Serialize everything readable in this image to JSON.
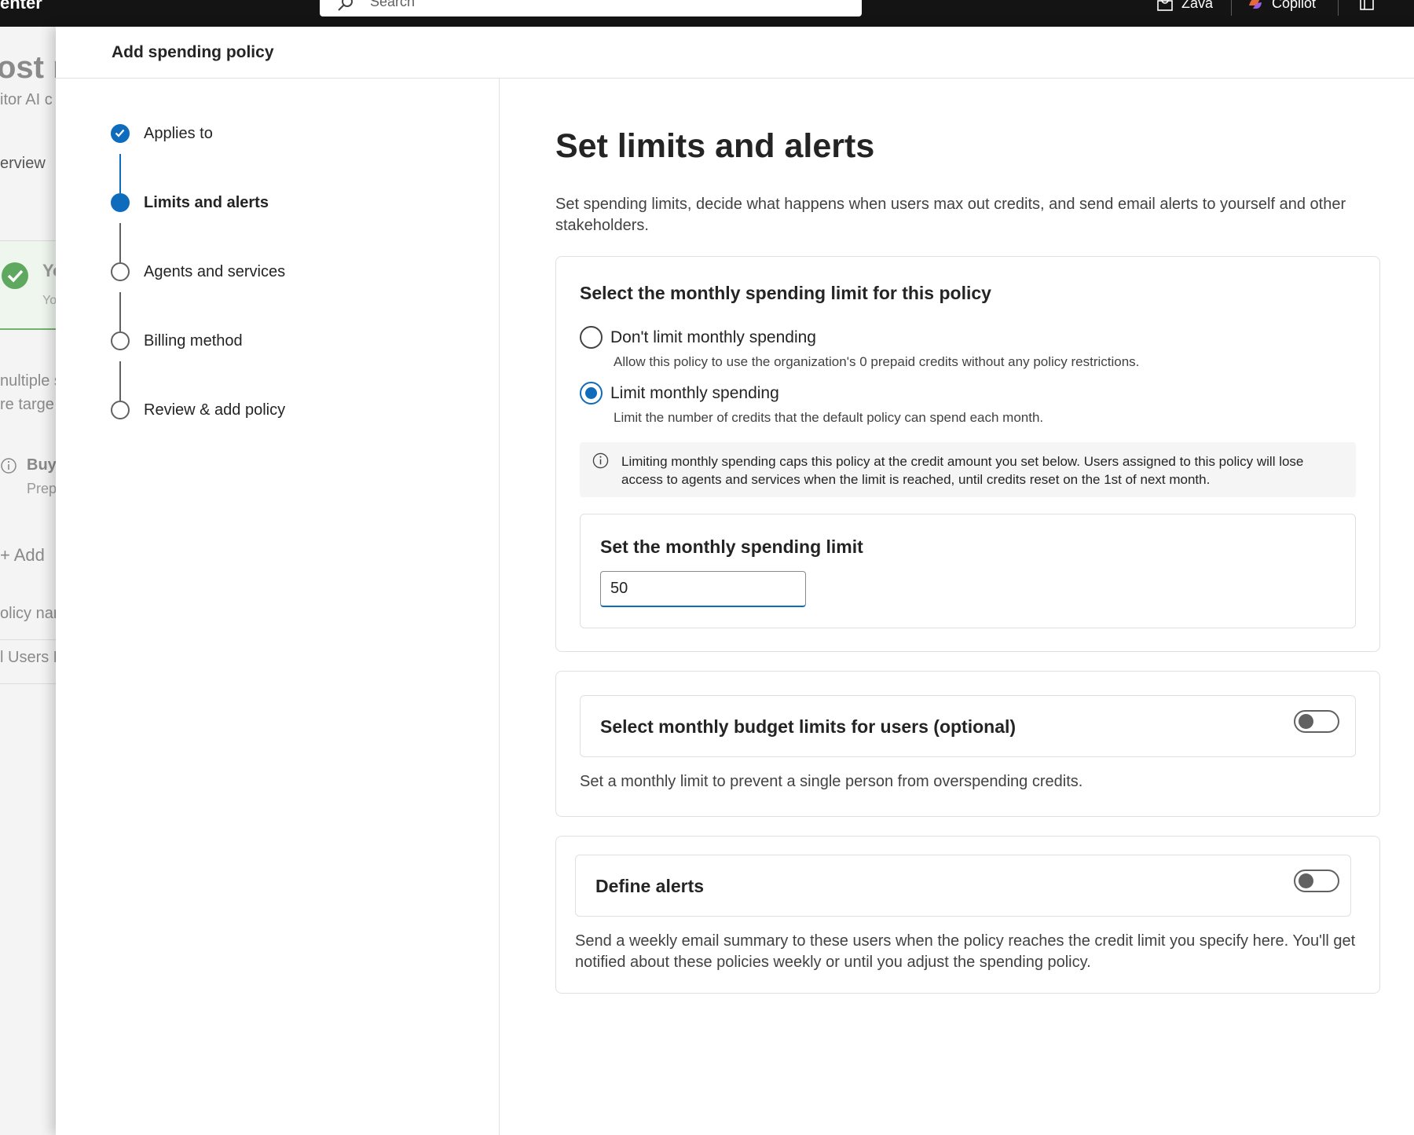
{
  "topbar": {
    "app_title_fragment": "enter",
    "search_placeholder": "Search",
    "org_name": "Zava",
    "copilot_label": "Copilot"
  },
  "background_page": {
    "title_fragment": "ost m",
    "subtitle_fragment": "itor AI c",
    "nav_overview": "erview",
    "status_title": "Yo",
    "status_sub": "Yo",
    "text_multiple": "nultiple s",
    "text_target": "re targe",
    "buy_title": "Buy",
    "buy_sub": "Prep",
    "add_button": "Add",
    "col_policy_name": "olicy nar",
    "row_users": "l Users F"
  },
  "panel": {
    "title": "Add spending policy",
    "steps": [
      {
        "label": "Applies to",
        "state": "done"
      },
      {
        "label": "Limits and alerts",
        "state": "current"
      },
      {
        "label": "Agents and services",
        "state": "pending"
      },
      {
        "label": "Billing method",
        "state": "pending"
      },
      {
        "label": "Review & add policy",
        "state": "pending"
      }
    ]
  },
  "main": {
    "heading": "Set limits and alerts",
    "intro": "Set spending limits, decide what happens when users max out credits, and send email alerts to yourself and other stakeholders.",
    "monthly_limit": {
      "title": "Select the monthly spending limit for this policy",
      "options": [
        {
          "label": "Don't limit monthly spending",
          "description": "Allow this policy to use the organization's 0 prepaid credits without any policy restrictions.",
          "selected": false
        },
        {
          "label": "Limit monthly spending",
          "description": "Limit the number of credits that the default policy can spend each month.",
          "selected": true
        }
      ],
      "info_text": "Limiting monthly spending caps this policy at the credit amount you set below. Users assigned to this policy will lose access to agents and services when the limit is reached, until credits reset on the 1st of next month.",
      "limit_title": "Set the monthly spending limit",
      "limit_value": "50"
    },
    "user_budget": {
      "title": "Select monthly budget limits for users (optional)",
      "description": "Set a monthly limit to prevent a single person from overspending credits.",
      "enabled": false
    },
    "alerts": {
      "title": "Define alerts",
      "description": "Send a weekly email summary to these users when the policy reaches the credit limit you specify here. You'll get notified about these policies weekly or until you adjust the spending policy.",
      "enabled": false
    }
  },
  "colors": {
    "accent": "#0f6cbd",
    "topbar": "#141414",
    "success": "#5fa85f"
  }
}
